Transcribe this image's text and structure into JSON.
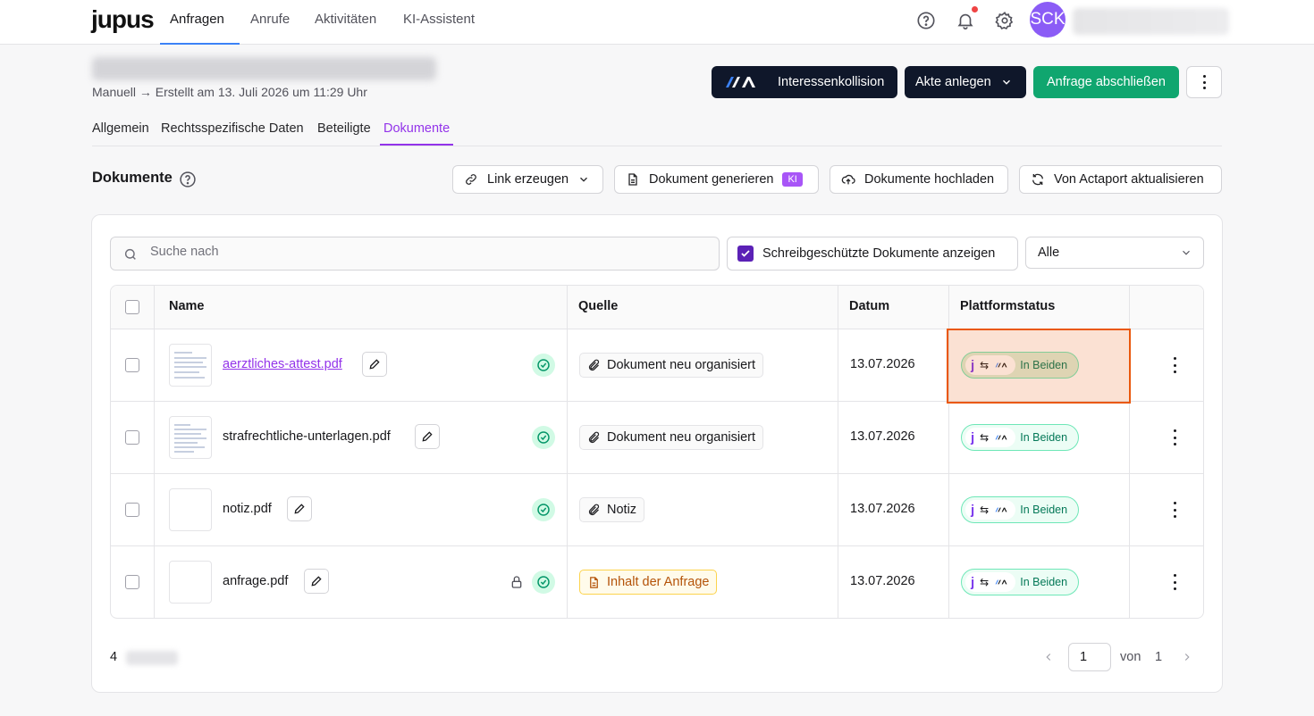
{
  "nav": {
    "logo": "jupus",
    "tabs": [
      "Anfragen",
      "Anrufe",
      "Aktivitäten",
      "KI-Assistent"
    ],
    "avatar_initials": "SCK"
  },
  "header": {
    "subtitle": "Manuell → Erstellt am 13. Juli 2026 um 11:29 Uhr",
    "btn_collision": "Interessenkollision",
    "btn_akte": "Akte anlegen",
    "btn_close": "Anfrage abschließen"
  },
  "subtabs": [
    "Allgemein",
    "Rechtsspezifische Daten",
    "Beteiligte",
    "Dokumente"
  ],
  "section": {
    "title": "Dokumente",
    "btn_link": "Link erzeugen",
    "btn_generate": "Dokument generieren",
    "badge_ki": "KI",
    "btn_upload": "Dokumente hochladen",
    "btn_actaport": "Von Actaport aktualisieren"
  },
  "filters": {
    "search_placeholder": "Suche nach",
    "readonly_label": "Schreibgeschützte Dokumente anzeigen",
    "select_value": "Alle"
  },
  "table": {
    "headers": {
      "name": "Name",
      "source": "Quelle",
      "date": "Datum",
      "status": "Plattformstatus"
    },
    "rows": [
      {
        "name": "aerztliches-attest.pdf",
        "source": "Dokument neu organisiert",
        "date": "13.07.2026",
        "status": "In Beiden"
      },
      {
        "name": "strafrechtliche-unterlagen.pdf",
        "source": "Dokument neu organisiert",
        "date": "13.07.2026",
        "status": "In Beiden"
      },
      {
        "name": "notiz.pdf",
        "source": "Notiz",
        "date": "13.07.2026",
        "status": "In Beiden"
      },
      {
        "name": "anfrage.pdf",
        "source": "Inhalt der Anfrage",
        "date": "13.07.2026",
        "status": "In Beiden"
      }
    ]
  },
  "footer": {
    "count": "4",
    "page": "1",
    "of_label": "von",
    "total_pages": "1"
  },
  "colors": {
    "accent": "#9333ea",
    "green": "#10a66f",
    "dark": "#0f172a",
    "highlight": "#ea580c"
  }
}
